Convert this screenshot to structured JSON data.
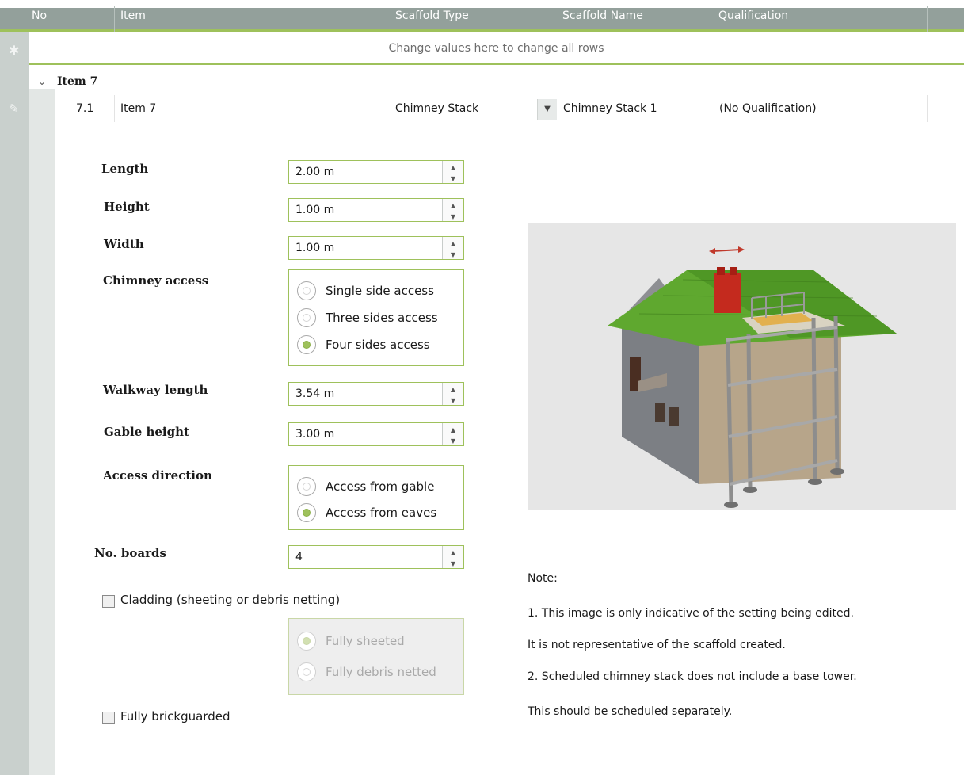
{
  "grid": {
    "columns": [
      "No",
      "Item",
      "Scaffold Type",
      "Scaffold Name",
      "Qualification"
    ],
    "new_row_hint": "Change values here to change all rows",
    "group_title": "Item 7",
    "row": {
      "no": "7.1",
      "item": "Item 7",
      "scaffold_type": "Chimney Stack",
      "scaffold_name": "Chimney Stack 1",
      "qualification": "(No Qualification)"
    }
  },
  "form": {
    "length": {
      "label": "Length",
      "value": "2.00 m"
    },
    "height": {
      "label": "Height",
      "value": "1.00 m"
    },
    "width": {
      "label": "Width",
      "value": "1.00 m"
    },
    "chimney_access": {
      "label": "Chimney access",
      "options": [
        "Single side access",
        "Three sides access",
        "Four sides access"
      ],
      "selected": "Four sides access"
    },
    "walkway_length": {
      "label": "Walkway length",
      "value": "3.54 m"
    },
    "gable_height": {
      "label": "Gable height",
      "value": "3.00 m"
    },
    "access_direction": {
      "label": "Access direction",
      "options": [
        "Access from gable",
        "Access from eaves"
      ],
      "selected": "Access from eaves"
    },
    "no_boards": {
      "label": "No. boards",
      "value": "4"
    },
    "cladding": {
      "label": "Cladding (sheeting or debris netting)",
      "checked": false,
      "options": [
        "Fully sheeted",
        "Fully debris netted"
      ],
      "selected": "Fully sheeted"
    },
    "brickguarded": {
      "label": "Fully brickguarded",
      "checked": false
    }
  },
  "notes": [
    "Note:",
    "1. This image is only indicative of the setting being edited.",
    "It is not representative of the scaffold created.",
    "2. Scheduled chimney stack does not include a base tower.",
    "This should be scheduled separately."
  ],
  "colors": {
    "accent": "#9ec15b",
    "header": "#93a09b",
    "roof": "#5fa82f",
    "chimney": "#c42a1e"
  }
}
